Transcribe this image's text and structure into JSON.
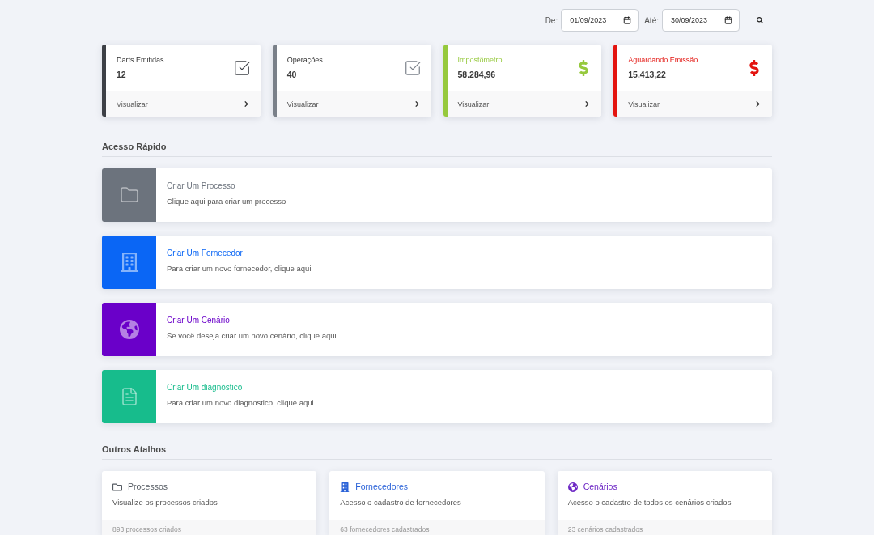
{
  "date_filter": {
    "from": {
      "label": "De:",
      "value": "01/09/2023"
    },
    "to": {
      "label": "Até:",
      "value": "30/09/2023"
    }
  },
  "stat_cards": [
    {
      "title": "Darfs Emitidas",
      "value": "12",
      "kind": "count",
      "color": "#3d4046",
      "link": "Visualizar"
    },
    {
      "title": "Operações",
      "value": "40",
      "kind": "count",
      "color": "#7a8089",
      "link": "Visualizar"
    },
    {
      "title": "Impostômetro",
      "value": "58.284,96",
      "kind": "money",
      "color": "#96c93d",
      "link": "Visualizar"
    },
    {
      "title": "Aguardando Emissão",
      "value": "15.413,22",
      "kind": "money",
      "color": "#e3140f",
      "link": "Visualizar"
    }
  ],
  "quick_access": {
    "title": "Acesso Rápido",
    "items": [
      {
        "title": "Criar Um Processo",
        "description": "Clique aqui para criar um processo",
        "kind": "folder",
        "color": "#6c737d"
      },
      {
        "title": "Criar Um Fornecedor",
        "description": "Para criar um novo fornecedor, clique aqui",
        "kind": "building",
        "color": "#0a66f5"
      },
      {
        "title": "Criar Um Cenário",
        "description": "Se você deseja criar um novo cenário, clique aqui",
        "kind": "globe",
        "color": "#6a00c9"
      },
      {
        "title": "Criar Um diagnóstico",
        "description": "Para criar um novo diagnostico, clique aqui.",
        "kind": "document",
        "color": "#17bc8c"
      }
    ]
  },
  "other_shortcuts": {
    "title": "Outros Atalhos",
    "cards": [
      {
        "title": "Processos",
        "description": "Visualize os processos criados",
        "footer": "893 processos criados",
        "kind": "folder",
        "color": "#555b63"
      },
      {
        "title": "Fornecedores",
        "description": "Acesso o cadastro de fornecedores",
        "footer": "63 fornecedores cadastrados",
        "kind": "building",
        "color": "#2a62d8"
      },
      {
        "title": "Cenários",
        "description": "Acesso o cadastro de todos os cenários criados",
        "footer": "23 cenários cadastrados",
        "kind": "globe",
        "color": "#6c26c4"
      }
    ]
  }
}
